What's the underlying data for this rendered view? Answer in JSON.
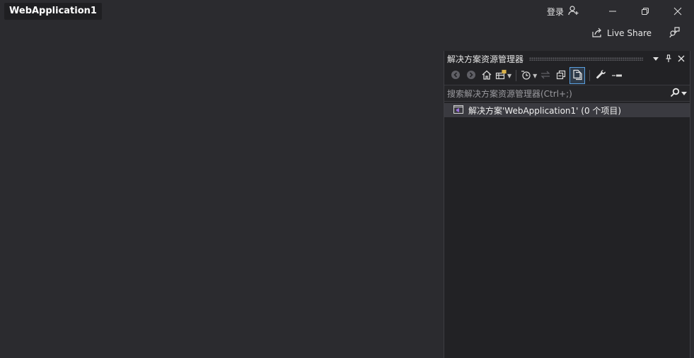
{
  "window": {
    "project_title": "WebApplication1"
  },
  "titlebar": {
    "sign_in_label": "登录",
    "live_share_label": "Live Share",
    "icons": [
      "person-add-icon",
      "minimize-icon",
      "restore-icon",
      "close-icon",
      "live-share-icon",
      "feedback-icon"
    ]
  },
  "solution_explorer": {
    "title": "解决方案资源管理器",
    "search_placeholder": "搜索解决方案资源管理器(Ctrl+;)",
    "tree": [
      {
        "label": "解决方案'WebApplication1' (0 个项目)",
        "icon": "solution-icon"
      }
    ],
    "toolbar_icons": [
      "back-icon",
      "forward-icon",
      "home-icon",
      "switch-views-icon",
      "pending-changes-icon",
      "sync-icon",
      "collapse-all-icon",
      "show-all-files-icon",
      "properties-icon",
      "preview-icon"
    ]
  },
  "colors": {
    "background": "#2b2b2f",
    "panel": "#222225",
    "selection": "#3a3a40",
    "accent": "#5aa0e0",
    "solution_icon": "#9b6fe0"
  }
}
